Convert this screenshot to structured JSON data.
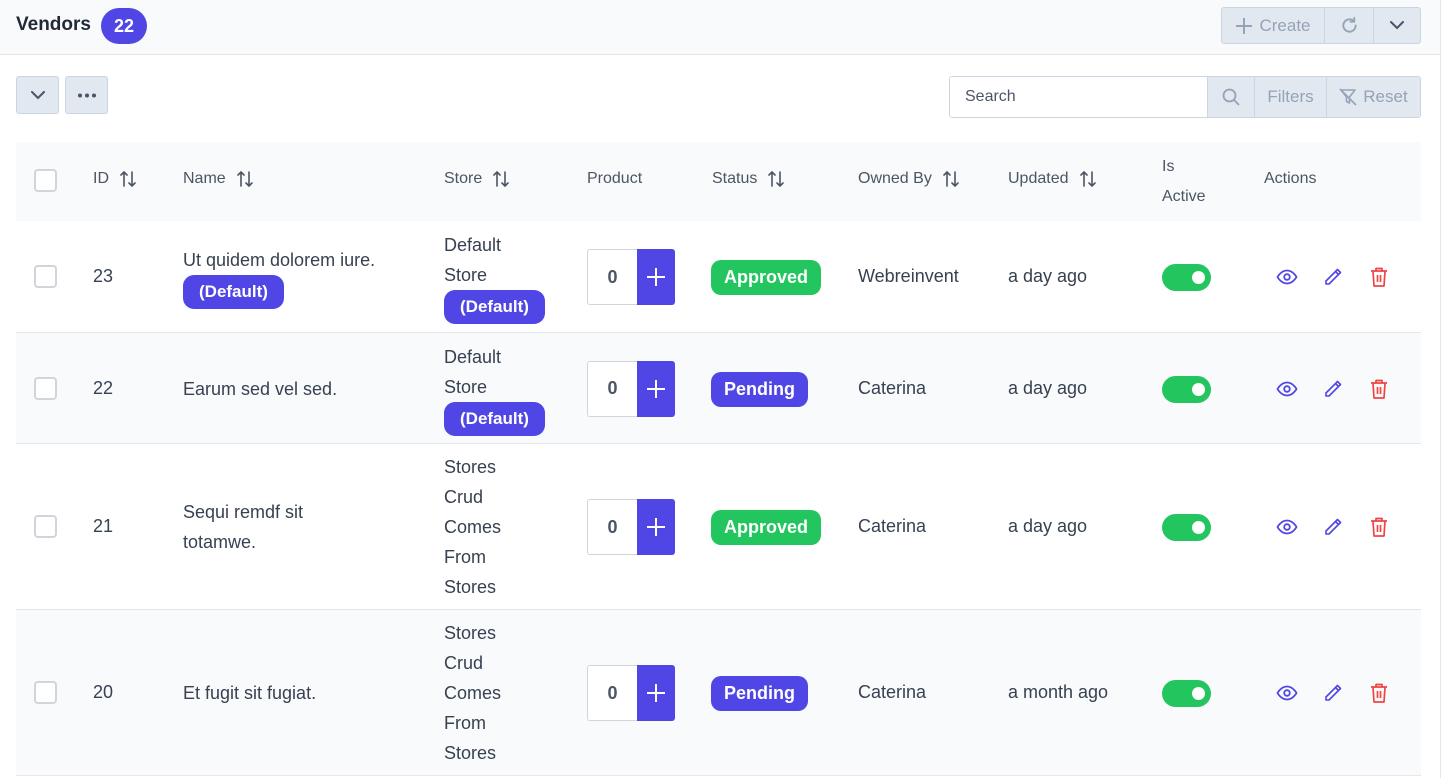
{
  "header": {
    "title": "Vendors",
    "count": "22",
    "create_label": "Create"
  },
  "toolbar": {
    "search_placeholder": "Search",
    "filters_label": "Filters",
    "reset_label": "Reset"
  },
  "columns": {
    "id": "ID",
    "name": "Name",
    "store": "Store",
    "product": "Product",
    "status": "Status",
    "owned_by": "Owned By",
    "updated": "Updated",
    "is_active_1": "Is",
    "is_active_2": "Active",
    "actions": "Actions"
  },
  "rows": [
    {
      "id": "23",
      "name_lines": [
        "Ut quidem dolorem iure."
      ],
      "name_badge": "(Default)",
      "store_lines": [
        "Default",
        "Store"
      ],
      "store_badge": "(Default)",
      "product_count": "0",
      "status": "Approved",
      "status_color": "#22c55e",
      "owned_by": "Webreinvent",
      "updated": "a day ago",
      "is_active": true
    },
    {
      "id": "22",
      "name_lines": [
        "Earum sed vel sed."
      ],
      "name_badge": "",
      "store_lines": [
        "Default",
        "Store"
      ],
      "store_badge": "(Default)",
      "product_count": "0",
      "status": "Pending",
      "status_color": "#4f46e5",
      "owned_by": "Caterina",
      "updated": "a day ago",
      "is_active": true
    },
    {
      "id": "21",
      "name_lines": [
        "Sequi remdf sit",
        "totamwe."
      ],
      "name_badge": "",
      "store_lines": [
        "Stores",
        "Crud",
        "Comes",
        "From",
        "Stores"
      ],
      "store_badge": "",
      "product_count": "0",
      "status": "Approved",
      "status_color": "#22c55e",
      "owned_by": "Caterina",
      "updated": "a day ago",
      "is_active": true
    },
    {
      "id": "20",
      "name_lines": [
        "Et fugit sit fugiat."
      ],
      "name_badge": "",
      "store_lines": [
        "Stores",
        "Crud",
        "Comes",
        "From",
        "Stores"
      ],
      "store_badge": "",
      "product_count": "0",
      "status": "Pending",
      "status_color": "#4f46e5",
      "owned_by": "Caterina",
      "updated": "a month ago",
      "is_active": true
    }
  ],
  "colors": {
    "accent": "#4f46e5",
    "success": "#22c55e",
    "danger": "#ef4444"
  }
}
